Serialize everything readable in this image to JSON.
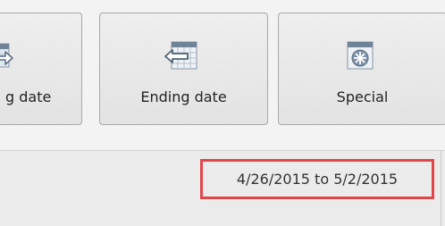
{
  "toolbar": {
    "buttons": [
      {
        "label": "g date",
        "icon": "start-date-arrow-icon"
      },
      {
        "label": "Ending date",
        "icon": "ending-date-arrow-icon"
      },
      {
        "label": "Special",
        "icon": "special-calendar-icon"
      }
    ]
  },
  "date_range": {
    "text": "4/26/2015 to 5/2/2015",
    "highlight_color": "#e0474b"
  }
}
